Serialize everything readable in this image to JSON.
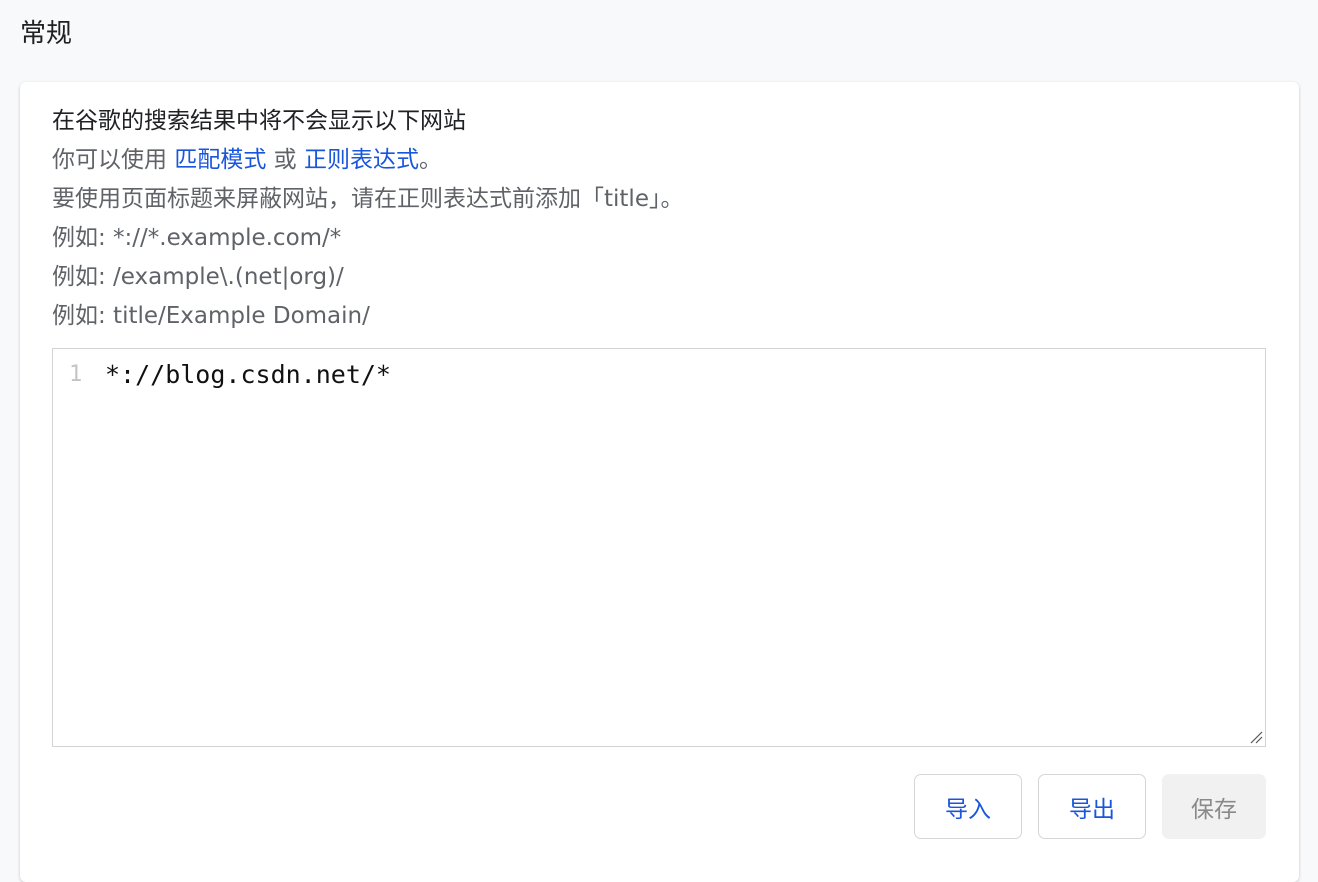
{
  "section": {
    "title": "常规"
  },
  "description": {
    "line1": "在谷歌的搜索结果中将不会显示以下网站",
    "line2_prefix": "你可以使用 ",
    "line2_link1": "匹配模式",
    "line2_mid": " 或 ",
    "line2_link2": "正则表达式",
    "line2_suffix": "。",
    "line3": "要使用页面标题来屏蔽网站，请在正则表达式前添加「title」。",
    "example1": "例如: *://*.example.com/*",
    "example2": "例如: /example\\.(net|org)/",
    "example3": "例如: title/Example Domain/"
  },
  "editor": {
    "lines": [
      {
        "number": "1",
        "text": "*://blog.csdn.net/*"
      }
    ]
  },
  "buttons": {
    "import_label": "导入",
    "export_label": "导出",
    "save_label": "保存"
  },
  "colors": {
    "link": "#1a56db",
    "background": "#f8f9fa",
    "card": "#ffffff"
  }
}
